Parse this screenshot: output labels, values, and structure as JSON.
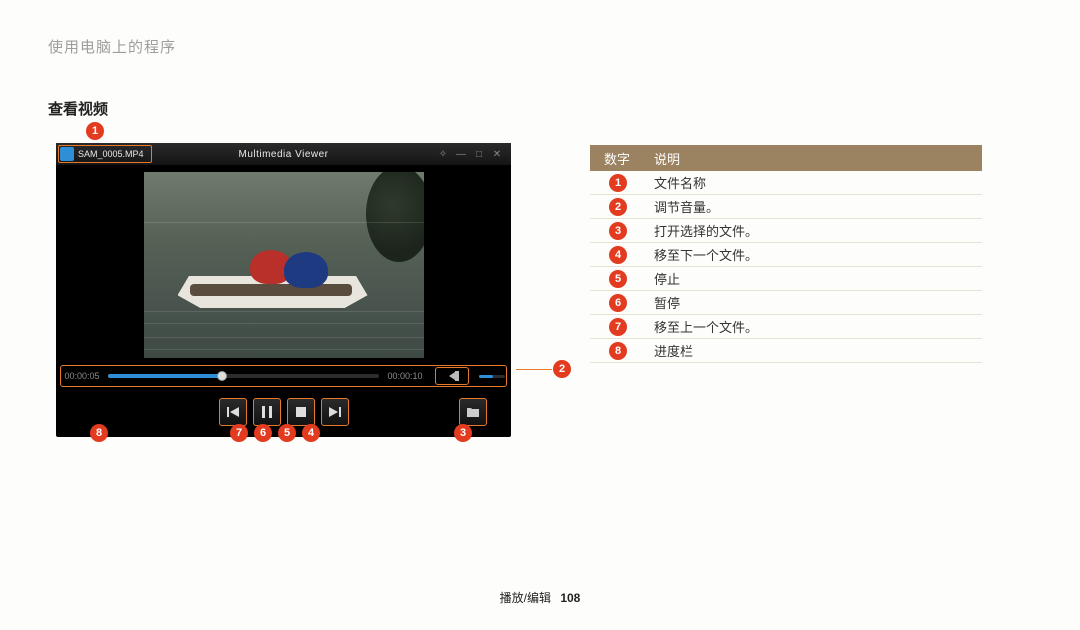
{
  "breadcrumb": "使用电脑上的程序",
  "section_title": "查看视频",
  "viewer": {
    "filename": "SAM_0005.MP4",
    "window_title": "Multimedia Viewer",
    "time_current": "00:00:05",
    "time_total": "00:00:10"
  },
  "callouts": [
    "1",
    "2",
    "3",
    "4",
    "5",
    "6",
    "7",
    "8"
  ],
  "table": {
    "head_num": "数字",
    "head_desc": "说明",
    "rows": [
      {
        "n": "1",
        "d": "文件名称"
      },
      {
        "n": "2",
        "d": "调节音量。"
      },
      {
        "n": "3",
        "d": "打开选择的文件。"
      },
      {
        "n": "4",
        "d": "移至下一个文件。"
      },
      {
        "n": "5",
        "d": "停止"
      },
      {
        "n": "6",
        "d": "暂停"
      },
      {
        "n": "7",
        "d": "移至上一个文件。"
      },
      {
        "n": "8",
        "d": "进度栏"
      }
    ]
  },
  "footer": {
    "section": "播放/编辑",
    "page": "108"
  }
}
